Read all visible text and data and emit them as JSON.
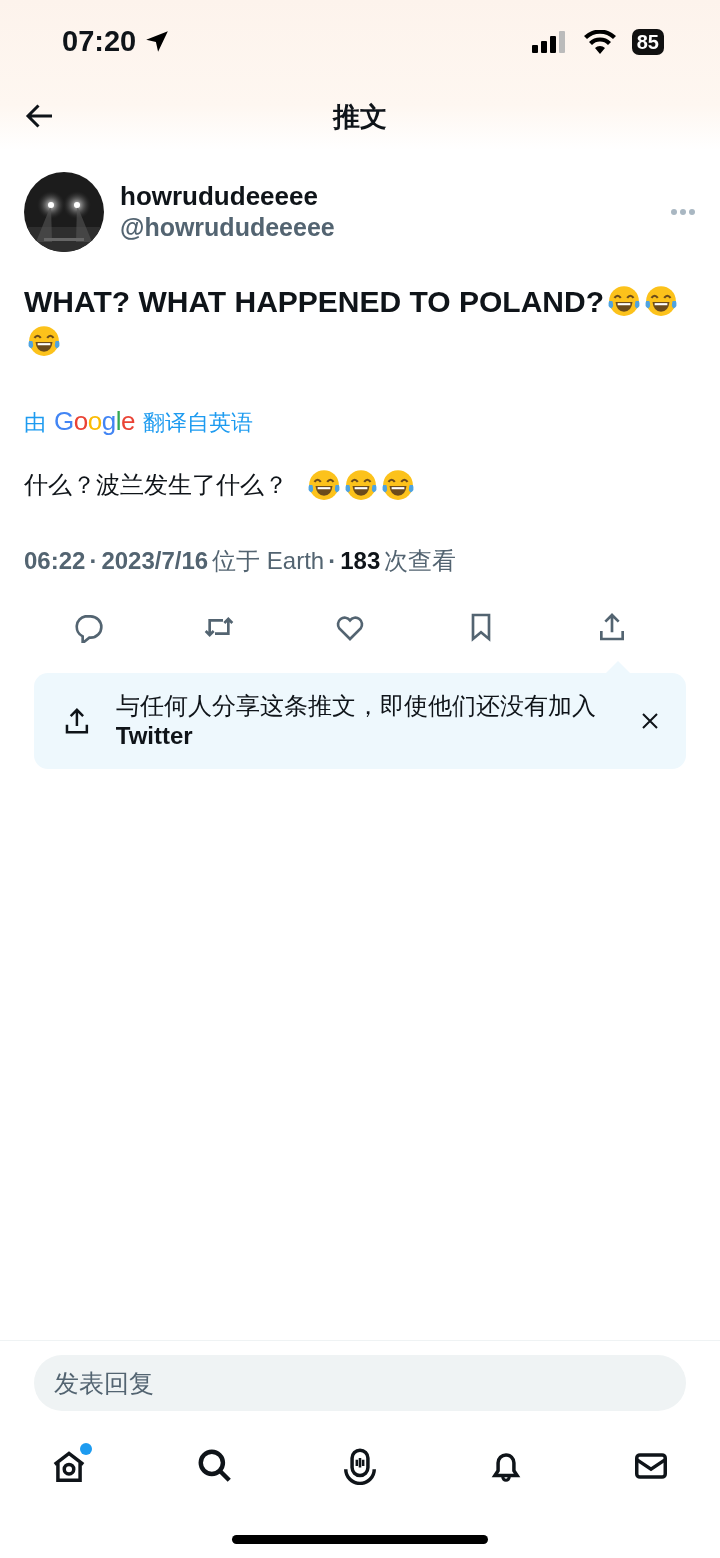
{
  "status_bar": {
    "time": "07:20",
    "battery": "85"
  },
  "header": {
    "title": "推文"
  },
  "tweet": {
    "display_name": "howrududeeeee",
    "handle": "@howrududeeeee",
    "text": "WHAT? WHAT HAPPENED TO POLAND?",
    "text_emoji": [
      {
        "kind": "tears-of-joy"
      },
      {
        "kind": "tears-of-joy"
      },
      {
        "kind": "tears-of-joy"
      }
    ],
    "translation_label": {
      "prefix": "由",
      "brand": "Google",
      "suffix": "翻译自英语"
    },
    "translated_text": "什么？波兰发生了什么？",
    "translated_emoji": [
      {
        "kind": "tears-of-joy"
      },
      {
        "kind": "tears-of-joy"
      },
      {
        "kind": "tears-of-joy"
      }
    ],
    "meta": {
      "separator": "·",
      "time": "06:22",
      "date": "2023/7/16",
      "location": "位于 Earth",
      "views": "183",
      "views_label": "次查看"
    },
    "actions": [
      {
        "kind": "reply"
      },
      {
        "kind": "retweet"
      },
      {
        "kind": "like"
      },
      {
        "kind": "bookmark"
      },
      {
        "kind": "share"
      }
    ]
  },
  "share_tip": {
    "text": "与任何人分享这条推文，即使他们还没有加入 **Twitter**"
  },
  "reply_field": {
    "placeholder": "发表回复"
  },
  "bottom_nav": [
    {
      "kind": "home",
      "unread": true
    },
    {
      "kind": "search",
      "unread": false
    },
    {
      "kind": "spaces",
      "unread": false
    },
    {
      "kind": "notifications",
      "unread": false
    },
    {
      "kind": "messages",
      "unread": false
    }
  ]
}
